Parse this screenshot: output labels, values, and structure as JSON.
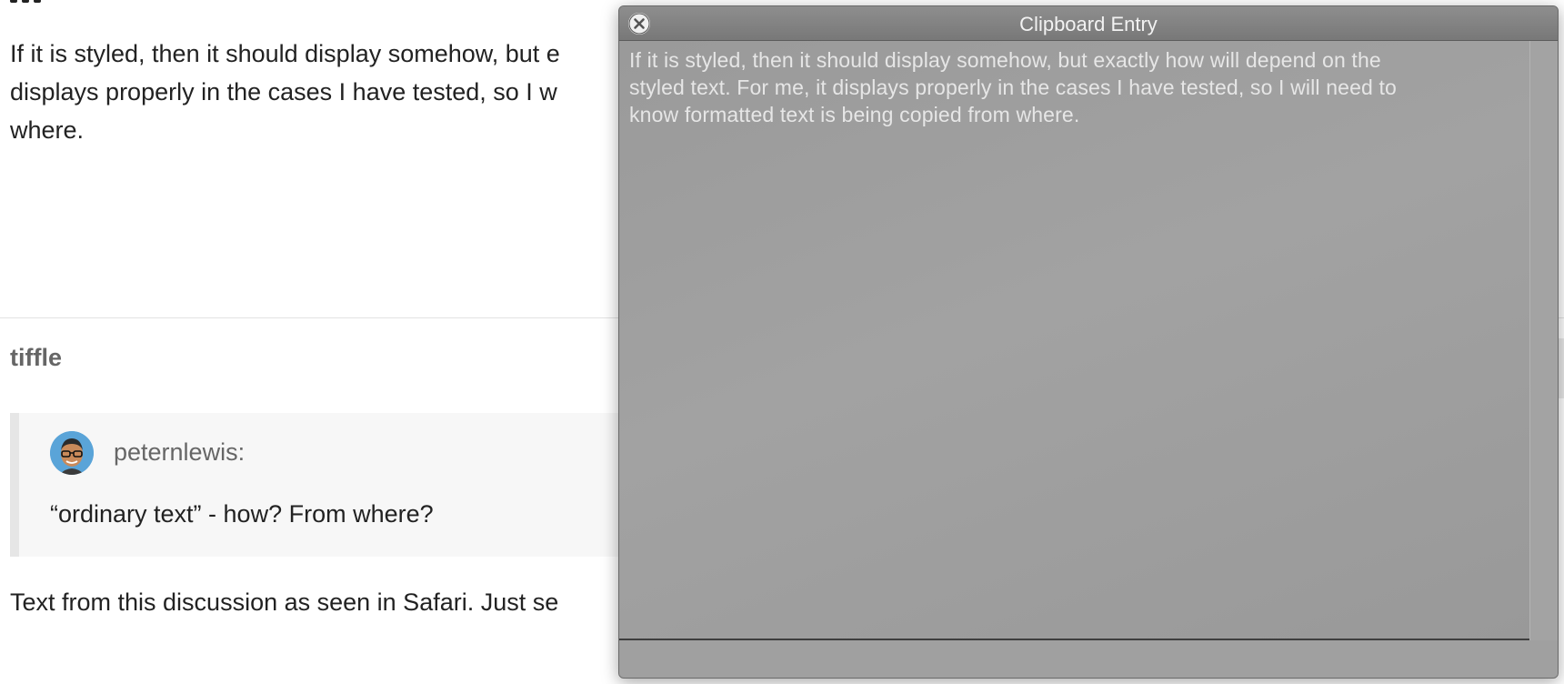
{
  "background_post": {
    "paragraph_1": "If it is styled, then it should display somehow, but e\ndisplays properly in the cases I have tested, so I w\nwhere.",
    "username": "tiffle",
    "quote": {
      "author": "peternlewis:",
      "text": "“ordinary text” - how? From where?"
    },
    "paragraph_2": "Text from this discussion as seen in Safari. Just se"
  },
  "clipboard_window": {
    "title": "Clipboard Entry",
    "content": "If it is styled, then it should display somehow, but exactly how will depend on the\nstyled text. For me, it displays properly in the cases I have tested, so I will need to\nknow formatted text is being copied from where.",
    "icons": {
      "close": "close-icon"
    }
  },
  "colors": {
    "window_background": "#9b9b9b",
    "window_text": "#e6e6e6",
    "page_text": "#222222",
    "username_gray": "#666666"
  }
}
